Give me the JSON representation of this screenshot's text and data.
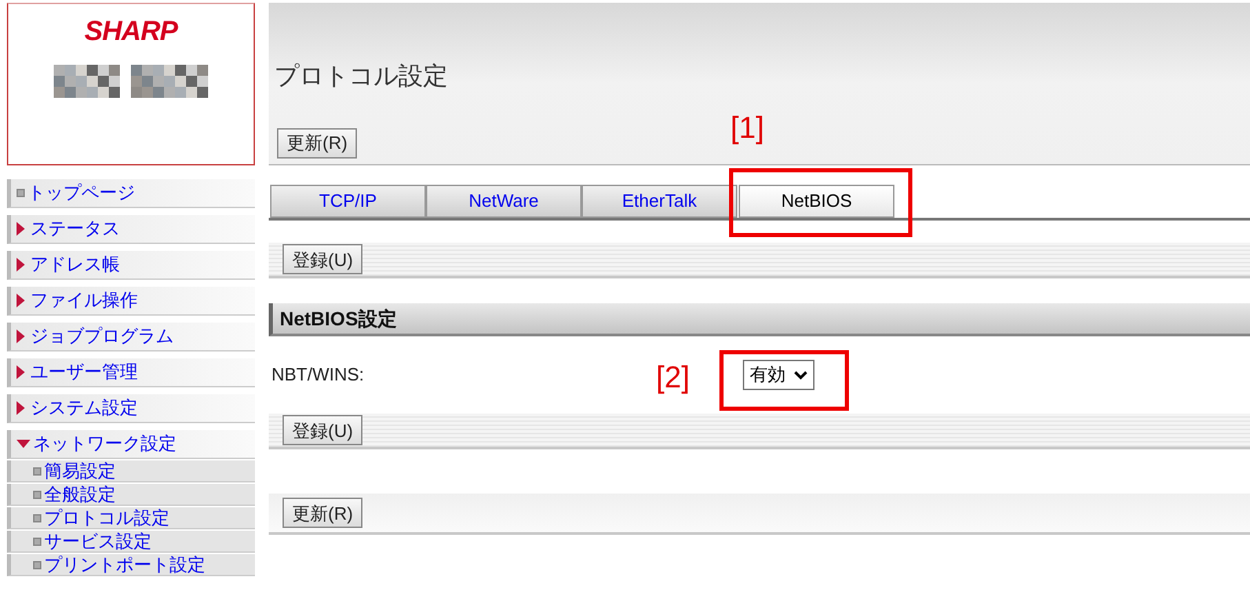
{
  "logo": {
    "brand": "SHARP"
  },
  "sidebar": {
    "items": [
      {
        "kind": "page",
        "label": "トップページ"
      },
      {
        "kind": "menu",
        "label": "ステータス",
        "expanded": false
      },
      {
        "kind": "menu",
        "label": "アドレス帳",
        "expanded": false
      },
      {
        "kind": "menu",
        "label": "ファイル操作",
        "expanded": false
      },
      {
        "kind": "menu",
        "label": "ジョブプログラム",
        "expanded": false
      },
      {
        "kind": "menu",
        "label": "ユーザー管理",
        "expanded": false
      },
      {
        "kind": "menu",
        "label": "システム設定",
        "expanded": false
      },
      {
        "kind": "menu",
        "label": "ネットワーク設定",
        "expanded": true,
        "children": [
          {
            "label": "簡易設定"
          },
          {
            "label": "全般設定"
          },
          {
            "label": "プロトコル設定"
          },
          {
            "label": "サービス設定"
          },
          {
            "label": "プリントポート設定"
          }
        ]
      }
    ]
  },
  "page_title": "プロトコル設定",
  "refresh_button_top": "更新(R)",
  "tabs": [
    {
      "label": "TCP/IP",
      "selected": false
    },
    {
      "label": "NetWare",
      "selected": false
    },
    {
      "label": "EtherTalk",
      "selected": false
    },
    {
      "label": "NetBIOS",
      "selected": true
    }
  ],
  "register_button_top": "登録(U)",
  "section_title": "NetBIOS設定",
  "field": {
    "label": "NBT/WINS:",
    "value": "有効"
  },
  "register_button_bottom": "登録(U)",
  "refresh_button_bottom": "更新(R)",
  "annotations": [
    {
      "label": "[1]"
    },
    {
      "label": "[2]"
    }
  ]
}
